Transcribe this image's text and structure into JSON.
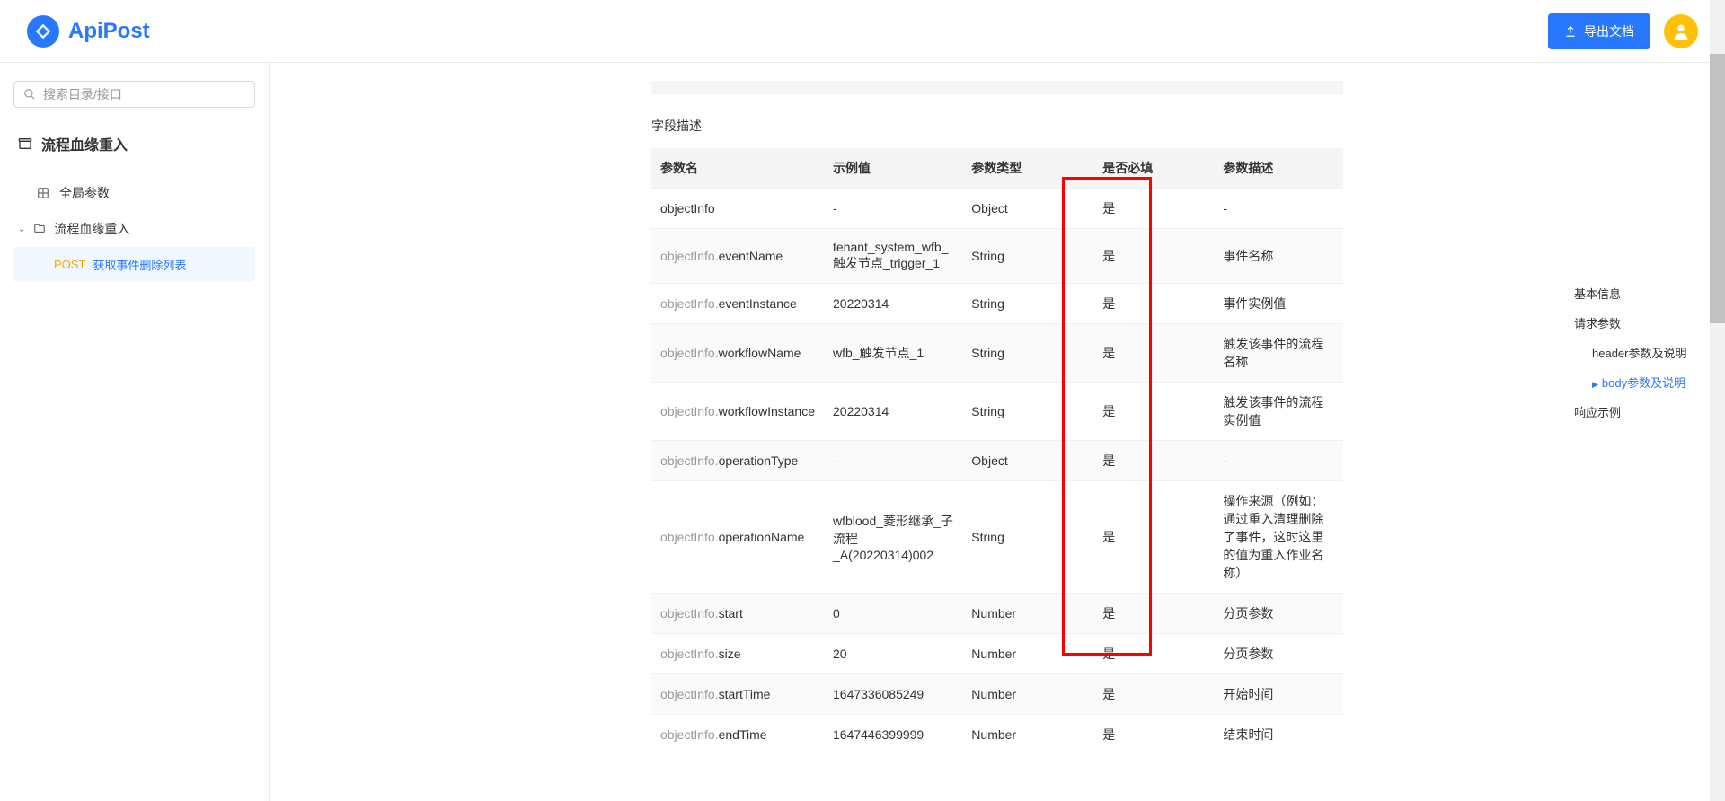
{
  "header": {
    "logo_text": "ApiPost",
    "export_label": "导出文档"
  },
  "sidebar": {
    "search_placeholder": "搜索目录/接口",
    "root_label": "流程血缘重入",
    "items": [
      {
        "type": "item",
        "label": "全局参数"
      },
      {
        "type": "folder",
        "label": "流程血缘重入",
        "expanded": true
      },
      {
        "type": "api",
        "method": "POST",
        "name": "获取事件删除列表",
        "active": true
      }
    ]
  },
  "main": {
    "section_title": "字段描述",
    "columns": {
      "name": "参数名",
      "example": "示例值",
      "type": "参数类型",
      "required": "是否必填",
      "desc": "参数描述"
    },
    "rows": [
      {
        "name_full": "objectInfo",
        "name_prefix": "",
        "name_suffix": "objectInfo",
        "example": "-",
        "type": "Object",
        "required": "是",
        "desc": "-"
      },
      {
        "name_prefix": "objectInfo.",
        "name_suffix": "eventName",
        "example": "tenant_system_wfb_触发节点_trigger_1",
        "type": "String",
        "required": "是",
        "desc": "事件名称"
      },
      {
        "name_prefix": "objectInfo.",
        "name_suffix": "eventInstance",
        "example": "20220314",
        "type": "String",
        "required": "是",
        "desc": "事件实例值"
      },
      {
        "name_prefix": "objectInfo.",
        "name_suffix": "workflowName",
        "example": "wfb_触发节点_1",
        "type": "String",
        "required": "是",
        "desc": "触发该事件的流程名称"
      },
      {
        "name_prefix": "objectInfo.",
        "name_suffix": "workflowInstance",
        "example": "20220314",
        "type": "String",
        "required": "是",
        "desc": "触发该事件的流程实例值"
      },
      {
        "name_prefix": "objectInfo.",
        "name_suffix": "operationType",
        "example": "-",
        "type": "Object",
        "required": "是",
        "desc": "-"
      },
      {
        "name_prefix": "objectInfo.",
        "name_suffix": "operationName",
        "example": "wfblood_菱形继承_子流程_A(20220314)002",
        "type": "String",
        "required": "是",
        "desc": "操作来源（例如：通过重入清理删除了事件，这时这里的值为重入作业名称）"
      },
      {
        "name_prefix": "objectInfo.",
        "name_suffix": "start",
        "example": "0",
        "type": "Number",
        "required": "是",
        "desc": "分页参数"
      },
      {
        "name_prefix": "objectInfo.",
        "name_suffix": "size",
        "example": "20",
        "type": "Number",
        "required": "是",
        "desc": "分页参数"
      },
      {
        "name_prefix": "objectInfo.",
        "name_suffix": "startTime",
        "example": "1647336085249",
        "type": "Number",
        "required": "是",
        "desc": "开始时间"
      },
      {
        "name_prefix": "objectInfo.",
        "name_suffix": "endTime",
        "example": "1647446399999",
        "type": "Number",
        "required": "是",
        "desc": "结束时间"
      }
    ]
  },
  "toc": {
    "items": [
      {
        "label": "基本信息",
        "active": false,
        "sub": false
      },
      {
        "label": "请求参数",
        "active": false,
        "sub": false
      },
      {
        "label": "header参数及说明",
        "active": false,
        "sub": true
      },
      {
        "label": "body参数及说明",
        "active": true,
        "sub": true
      },
      {
        "label": "响应示例",
        "active": false,
        "sub": false
      }
    ]
  }
}
